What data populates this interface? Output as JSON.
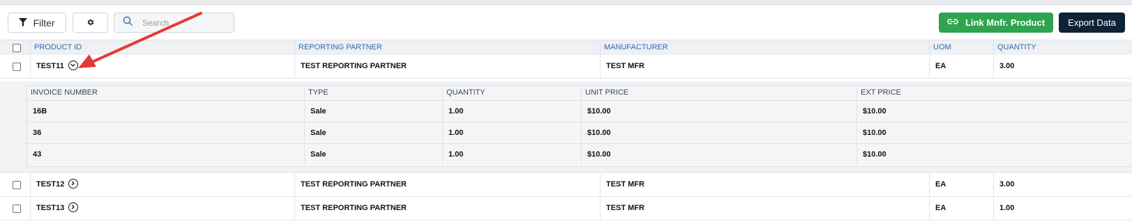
{
  "toolbar": {
    "filter_label": "Filter",
    "search_placeholder": "Search",
    "link_label": "Link Mnfr. Product",
    "export_label": "Export Data",
    "icons": [
      "filter-icon",
      "gear-icon",
      "search-icon",
      "link-icon"
    ]
  },
  "table": {
    "columns": [
      "PRODUCT ID",
      "REPORTING PARTNER",
      "MANUFACTURER",
      "UOM",
      "QUANTITY"
    ],
    "rows": [
      {
        "product_id": "TEST11",
        "partner": "TEST REPORTING PARTNER",
        "manufacturer": "TEST MFR",
        "uom": "EA",
        "quantity": "3.00",
        "expanded": true
      },
      {
        "product_id": "TEST12",
        "partner": "TEST REPORTING PARTNER",
        "manufacturer": "TEST MFR",
        "uom": "EA",
        "quantity": "3.00",
        "expanded": false
      },
      {
        "product_id": "TEST13",
        "partner": "TEST REPORTING PARTNER",
        "manufacturer": "TEST MFR",
        "uom": "EA",
        "quantity": "1.00",
        "expanded": false
      }
    ]
  },
  "subtable": {
    "columns": [
      "INVOICE NUMBER",
      "TYPE",
      "QUANTITY",
      "UNIT PRICE",
      "EXT PRICE"
    ],
    "rows": [
      {
        "invoice": "16B",
        "type": "Sale",
        "quantity": "1.00",
        "unit_price": "$10.00",
        "ext_price": "$10.00"
      },
      {
        "invoice": "36",
        "type": "Sale",
        "quantity": "1.00",
        "unit_price": "$10.00",
        "ext_price": "$10.00"
      },
      {
        "invoice": "43",
        "type": "Sale",
        "quantity": "1.00",
        "unit_price": "$10.00",
        "ext_price": "$10.00"
      }
    ]
  },
  "colors": {
    "accent_green": "#2ea44f",
    "export_navy": "#0f2336",
    "header_blue": "#2b6cb0",
    "annotation_arrow": "#e53935"
  }
}
